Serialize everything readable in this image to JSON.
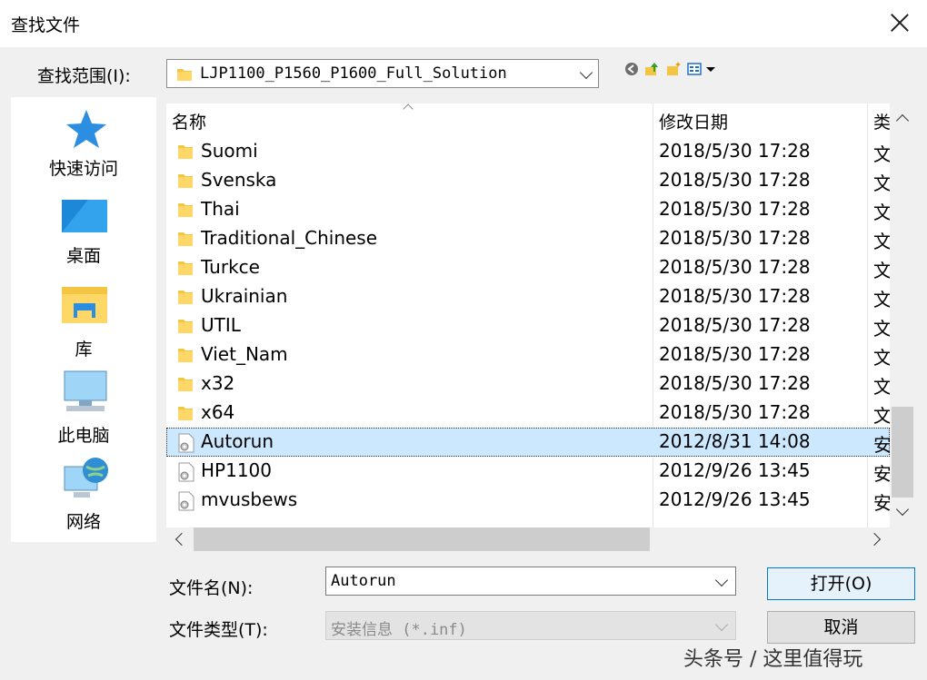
{
  "window": {
    "title": "查找文件"
  },
  "toolbar": {
    "lookin_label": "查找范围(I):",
    "lookin_value": "LJP1100_P1560_P1600_Full_Solution"
  },
  "places": [
    {
      "label": "快速访问",
      "icon": "star-icon"
    },
    {
      "label": "桌面",
      "icon": "desktop-icon"
    },
    {
      "label": "库",
      "icon": "library-icon"
    },
    {
      "label": "此电脑",
      "icon": "computer-icon"
    },
    {
      "label": "网络",
      "icon": "network-icon"
    }
  ],
  "columns": {
    "name": "名称",
    "date": "修改日期",
    "type": "类"
  },
  "files": [
    {
      "name": "Suomi",
      "date": "2018/5/30 17:28",
      "type": "文",
      "kind": "folder"
    },
    {
      "name": "Svenska",
      "date": "2018/5/30 17:28",
      "type": "文",
      "kind": "folder"
    },
    {
      "name": "Thai",
      "date": "2018/5/30 17:28",
      "type": "文",
      "kind": "folder"
    },
    {
      "name": "Traditional_Chinese",
      "date": "2018/5/30 17:28",
      "type": "文",
      "kind": "folder"
    },
    {
      "name": "Turkce",
      "date": "2018/5/30 17:28",
      "type": "文",
      "kind": "folder"
    },
    {
      "name": "Ukrainian",
      "date": "2018/5/30 17:28",
      "type": "文",
      "kind": "folder"
    },
    {
      "name": "UTIL",
      "date": "2018/5/30 17:28",
      "type": "文",
      "kind": "folder"
    },
    {
      "name": "Viet_Nam",
      "date": "2018/5/30 17:28",
      "type": "文",
      "kind": "folder"
    },
    {
      "name": "x32",
      "date": "2018/5/30 17:28",
      "type": "文",
      "kind": "folder"
    },
    {
      "name": "x64",
      "date": "2018/5/30 17:28",
      "type": "文",
      "kind": "folder"
    },
    {
      "name": "Autorun",
      "date": "2012/8/31 14:08",
      "type": "安",
      "kind": "inf",
      "selected": true
    },
    {
      "name": "HP1100",
      "date": "2012/9/26 13:45",
      "type": "安",
      "kind": "inf"
    },
    {
      "name": "mvusbews",
      "date": "2012/9/26 13:45",
      "type": "安",
      "kind": "inf"
    }
  ],
  "form": {
    "filename_label": "文件名(N):",
    "filename_value": "Autorun",
    "filetype_label": "文件类型(T):",
    "filetype_value": "安装信息 (*.inf)"
  },
  "buttons": {
    "open": "打开(O)",
    "cancel": "取消"
  },
  "watermark": "头条号 / 这里值得玩",
  "colors": {
    "selection": "#cce8ff",
    "default_button_border": "#0078d7",
    "folder": "#f4c542"
  }
}
